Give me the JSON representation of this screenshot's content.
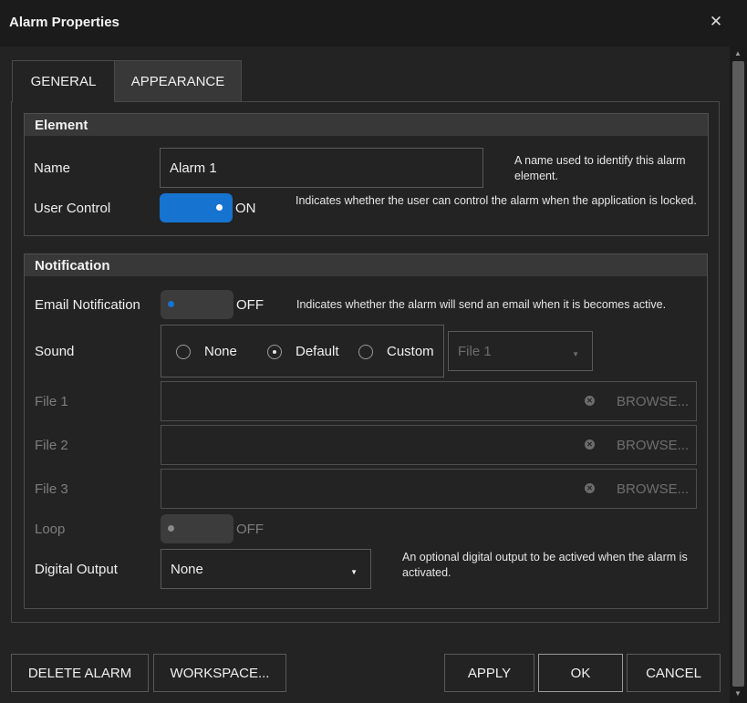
{
  "window": {
    "title": "Alarm Properties",
    "close_glyph": "✕"
  },
  "tabs": [
    {
      "label": "GENERAL",
      "active": true
    },
    {
      "label": "APPEARANCE",
      "active": false
    }
  ],
  "element": {
    "header": "Element",
    "name_label": "Name",
    "name_value": "Alarm 1",
    "name_desc": "A name used to identify this alarm element.",
    "user_control_label": "User Control",
    "user_control_state": "ON",
    "user_control_desc": "Indicates whether the user can control the alarm when the application is locked."
  },
  "notification": {
    "header": "Notification",
    "email_label": "Email Notification",
    "email_state": "OFF",
    "email_desc": "Indicates whether the alarm will send an email when it is becomes active.",
    "sound_label": "Sound",
    "sound_options": [
      {
        "label": "None",
        "checked": false
      },
      {
        "label": "Default",
        "checked": true
      },
      {
        "label": "Custom",
        "checked": false
      }
    ],
    "sound_file_select": "File 1",
    "files": [
      {
        "label": "File 1",
        "browse": "BROWSE..."
      },
      {
        "label": "File 2",
        "browse": "BROWSE..."
      },
      {
        "label": "File 3",
        "browse": "BROWSE..."
      }
    ],
    "loop_label": "Loop",
    "loop_state": "OFF",
    "digital_output_label": "Digital Output",
    "digital_output_value": "None",
    "digital_output_desc": "An optional digital output to be actived when the alarm is activated."
  },
  "buttons": {
    "delete": "DELETE ALARM",
    "workspace": "WORKSPACE...",
    "apply": "APPLY",
    "ok": "OK",
    "cancel": "CANCEL"
  },
  "colors": {
    "accent": "#1673d0",
    "background": "#232323",
    "header_bg": "#383838"
  },
  "icons": {
    "clear": "clear-circle-icon",
    "dropdown": "caret-down-icon",
    "radio": "radio-circle-icon"
  }
}
